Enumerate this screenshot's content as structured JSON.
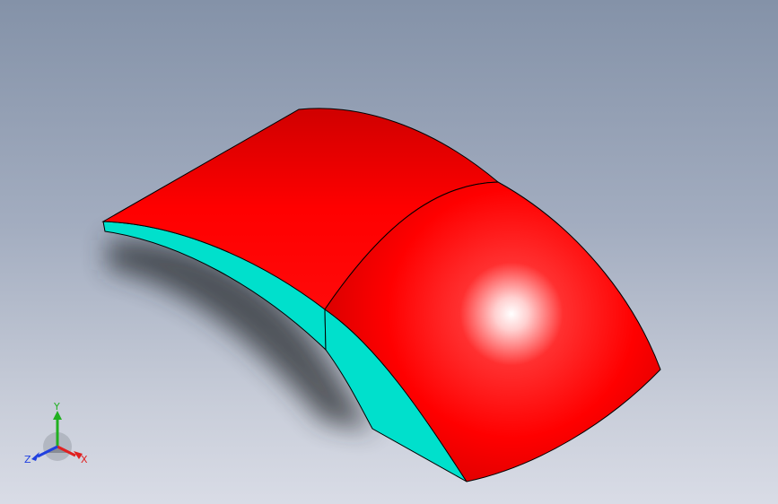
{
  "colors": {
    "background_top": "#8492a8",
    "background_bottom": "#d9dce6",
    "body_face": "#ff0000",
    "side_face": "#00e0cc",
    "edge": "#000000",
    "shadow": "#2a2d33"
  },
  "triad": {
    "x_label": "X",
    "y_label": "Y",
    "z_label": "Z",
    "x_color": "#e02020",
    "y_color": "#20b020",
    "z_color": "#2040e0"
  }
}
